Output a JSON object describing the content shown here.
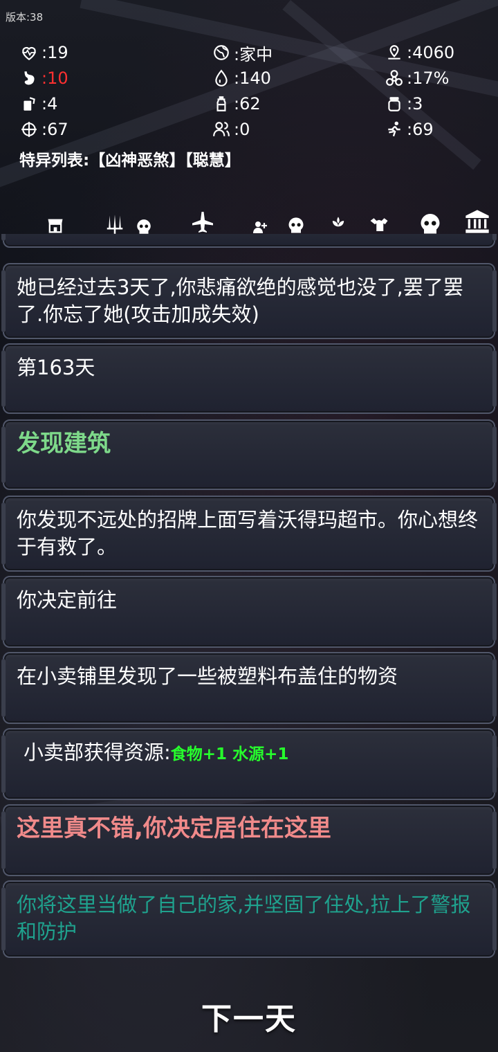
{
  "version": "版本:38",
  "stats": {
    "health": ":19",
    "location": ":家中",
    "distance": ":4060",
    "hunger": ":10",
    "water": ":140",
    "infection": ":17%",
    "food": ":4",
    "bottles": ":62",
    "jars": ":3",
    "aim": ":67",
    "survivors": ":0",
    "agility": ":69"
  },
  "traits": "特异列表:【凶神恶煞】【聪慧】",
  "toolbar": {
    "icons": [
      "shop-icon",
      "weapons-icon",
      "skull-icon",
      "airplane-icon",
      "add-survivor-icon",
      "skull-icon",
      "plant-icon",
      "strength-icon",
      "skull-icon",
      "bank-icon"
    ]
  },
  "log": {
    "partial": "",
    "e1": "她已经过去3天了,你悲痛欲绝的感觉也没了,罢了罢了.你忘了她(攻击加成失效)",
    "e2": "第163天",
    "e3": "发现建筑",
    "e4": "你发现不远处的招牌上面写着沃得玛超市。你心想终于有救了。",
    "e5": "你决定前往",
    "e6": "在小卖铺里发现了一些被塑料布盖住的物资",
    "e7_prefix": "小卖部获得资源:",
    "e7_res": "食物+1 水源+1",
    "e8": "这里真不错,你决定居住在这里",
    "e9": "你将这里当做了自己的家,并坚固了住处,拉上了警报和防护"
  },
  "next_button": "下一天",
  "colors": {
    "red_stat": "#ff3030",
    "green_title": "#7ed98a",
    "green_resource": "#26ff2c",
    "pink_title": "#f08a8a",
    "teal_text": "#1fa28e"
  }
}
